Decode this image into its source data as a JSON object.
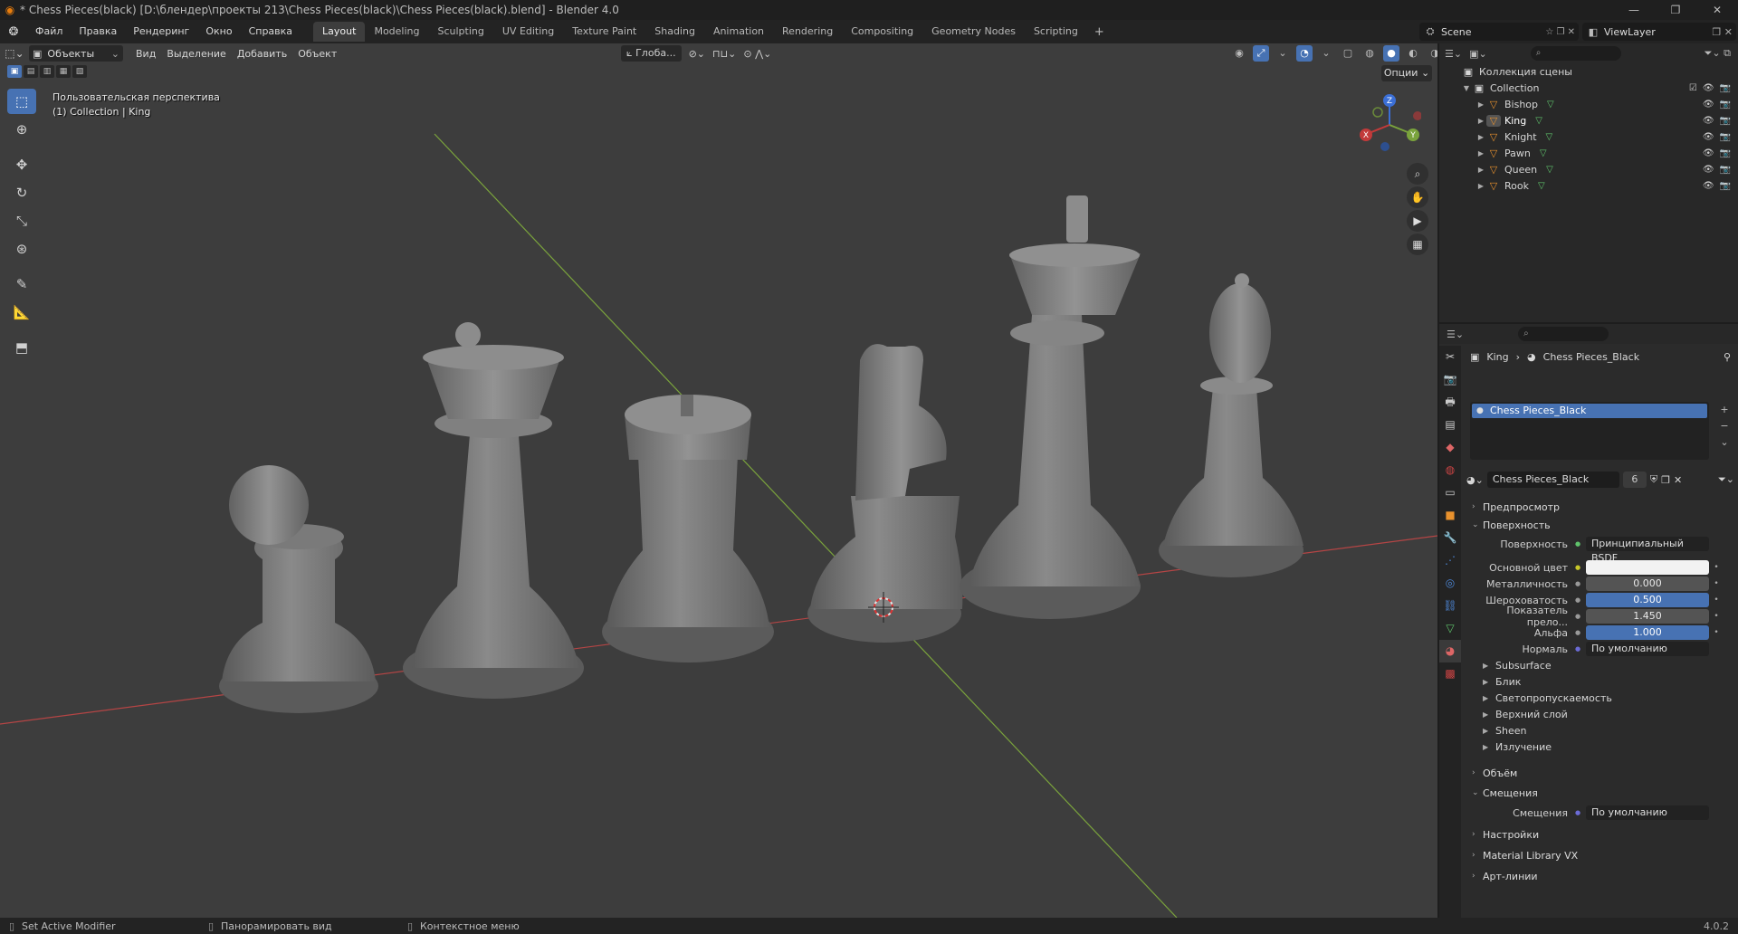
{
  "window": {
    "title": "* Chess Pieces(black) [D:\\блендер\\проекты 213\\Chess Pieces(black)\\Chess Pieces(black).blend] - Blender 4.0",
    "minimize": "—",
    "maximize": "❐",
    "close": "✕"
  },
  "menu": [
    "Файл",
    "Правка",
    "Рендеринг",
    "Окно",
    "Справка"
  ],
  "workspaces": [
    "Layout",
    "Modeling",
    "Sculpting",
    "UV Editing",
    "Texture Paint",
    "Shading",
    "Animation",
    "Rendering",
    "Compositing",
    "Geometry Nodes",
    "Scripting"
  ],
  "workspace_add": "+",
  "scene": {
    "label": "Scene",
    "viewlayer": "ViewLayer"
  },
  "viewport": {
    "mode": "Объекты",
    "menus": [
      "Вид",
      "Выделение",
      "Добавить",
      "Объект"
    ],
    "transform_orientation": "Глоба...",
    "options": "Опции",
    "info_line1": "Пользовательская перспектива",
    "info_line2": "(1) Collection | King",
    "gizmo": {
      "x": "X",
      "y": "Y",
      "z": "Z"
    }
  },
  "outliner": {
    "scene_collection": "Коллекция сцены",
    "collection": "Collection",
    "objects": [
      "Bishop",
      "King",
      "Knight",
      "Pawn",
      "Queen",
      "Rook"
    ],
    "active_object": "King"
  },
  "properties": {
    "breadcrumb_object": "King",
    "breadcrumb_material": "Chess Pieces_Black",
    "slot_name": "Chess Pieces_Black",
    "material_name": "Chess Pieces_Black",
    "material_users": "6",
    "panels": {
      "preview": "Предпросмотр",
      "surface": "Поверхность",
      "volume": "Объём",
      "displacement": "Смещения",
      "settings": "Настройки",
      "material_library": "Material Library VX",
      "line_art": "Арт-линии"
    },
    "surface_row": {
      "label": "Поверхность",
      "value": "Принципиальный BSDF"
    },
    "fields": [
      {
        "label": "Основной цвет",
        "value": "",
        "style": "white"
      },
      {
        "label": "Металличность",
        "value": "0.000",
        "style": "gray"
      },
      {
        "label": "Шероховатость",
        "value": "0.500",
        "style": "blue"
      },
      {
        "label": "Показатель прело...",
        "value": "1.450",
        "style": "gray"
      },
      {
        "label": "Альфа",
        "value": "1.000",
        "style": "blue"
      },
      {
        "label": "Нормаль",
        "value": "По умолчанию",
        "style": "dark"
      }
    ],
    "subpanels": [
      "Subsurface",
      "Блик",
      "Светопропускаемость",
      "Верхний слой",
      "Sheen",
      "Излучение"
    ],
    "displacement_row": {
      "label": "Смещения",
      "value": "По умолчанию"
    }
  },
  "status": {
    "left": "Set Active Modifier",
    "middle": "Панорамировать вид",
    "right": "Контекстное меню",
    "version": "4.0.2"
  },
  "colors": {
    "accent": "#4772b3",
    "object_orange": "#e8912d",
    "mesh_green": "#5fc36b",
    "viewport_bg": "#3d3d3d",
    "axis_x": "#c23a3a",
    "axis_y": "#7aa33c"
  }
}
